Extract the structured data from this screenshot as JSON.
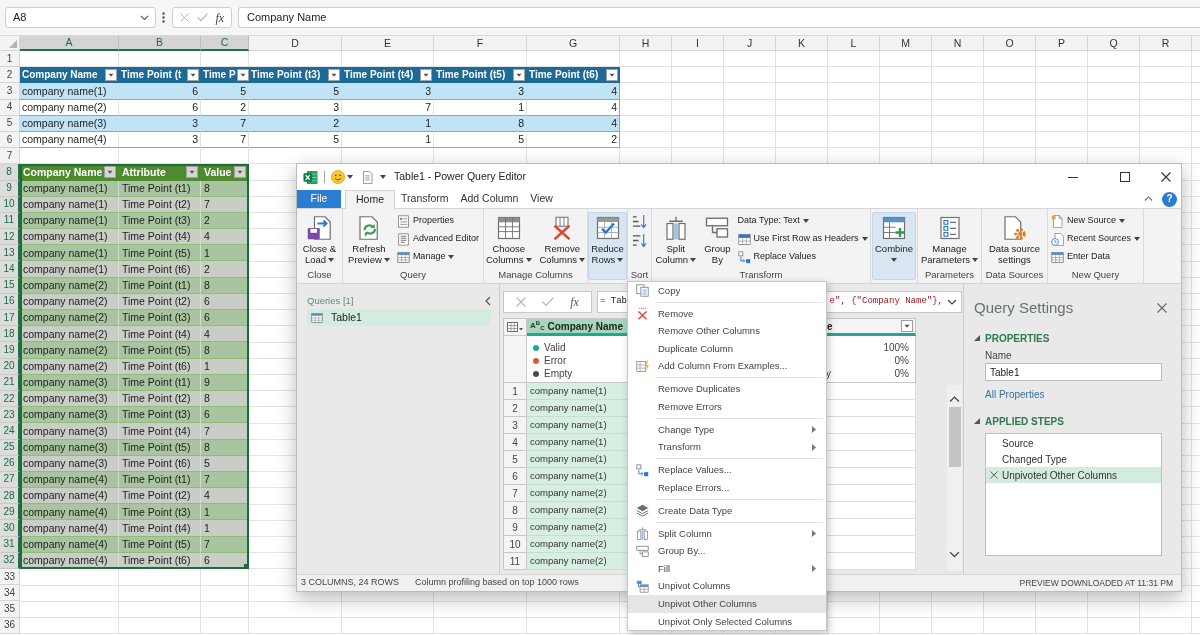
{
  "formula_bar": {
    "name_box": "A8",
    "fx": "fx",
    "formula": "Company Name"
  },
  "sheet": {
    "columns": [
      {
        "label": "A",
        "selected": true
      },
      {
        "label": "B",
        "selected": true
      },
      {
        "label": "C",
        "selected": true
      },
      {
        "label": "D",
        "selected": false
      },
      {
        "label": "E",
        "selected": false
      },
      {
        "label": "F",
        "selected": false
      },
      {
        "label": "G",
        "selected": false
      },
      {
        "label": "H",
        "selected": false
      },
      {
        "label": "I",
        "selected": false
      },
      {
        "label": "J",
        "selected": false
      },
      {
        "label": "K",
        "selected": false
      },
      {
        "label": "L",
        "selected": false
      },
      {
        "label": "M",
        "selected": false
      },
      {
        "label": "N",
        "selected": false
      },
      {
        "label": "O",
        "selected": false
      },
      {
        "label": "P",
        "selected": false
      },
      {
        "label": "Q",
        "selected": false
      },
      {
        "label": "R",
        "selected": false
      }
    ],
    "rows": [
      {
        "label": "1",
        "selected": false
      },
      {
        "label": "2",
        "selected": false
      },
      {
        "label": "3",
        "selected": false
      },
      {
        "label": "4",
        "selected": false
      },
      {
        "label": "5",
        "selected": false
      },
      {
        "label": "6",
        "selected": false
      },
      {
        "label": "7",
        "selected": false
      },
      {
        "label": "8",
        "selected": true
      },
      {
        "label": "9",
        "selected": true
      },
      {
        "label": "10",
        "selected": true
      },
      {
        "label": "11",
        "selected": true
      },
      {
        "label": "12",
        "selected": true
      },
      {
        "label": "13",
        "selected": true
      },
      {
        "label": "14",
        "selected": true
      },
      {
        "label": "15",
        "selected": true
      },
      {
        "label": "16",
        "selected": true
      },
      {
        "label": "17",
        "selected": true
      },
      {
        "label": "18",
        "selected": true
      },
      {
        "label": "19",
        "selected": true
      },
      {
        "label": "20",
        "selected": true
      },
      {
        "label": "21",
        "selected": true
      },
      {
        "label": "22",
        "selected": true
      },
      {
        "label": "23",
        "selected": true
      },
      {
        "label": "24",
        "selected": true
      },
      {
        "label": "25",
        "selected": true
      },
      {
        "label": "26",
        "selected": true
      },
      {
        "label": "27",
        "selected": true
      },
      {
        "label": "28",
        "selected": true
      },
      {
        "label": "29",
        "selected": true
      },
      {
        "label": "30",
        "selected": true
      },
      {
        "label": "31",
        "selected": true
      },
      {
        "label": "32",
        "selected": true
      },
      {
        "label": "33",
        "selected": false
      },
      {
        "label": "34",
        "selected": false
      },
      {
        "label": "35",
        "selected": false
      },
      {
        "label": "36",
        "selected": false
      }
    ]
  },
  "table_1": {
    "headers": [
      "Company Name",
      "Time Point (t",
      "Time P",
      "Time Point (t3)",
      "Time Point (t4)",
      "Time Point (t5)",
      "Time Point (t6)"
    ],
    "rows": [
      [
        "company name(1)",
        "6",
        "5",
        "5",
        "3",
        "3",
        "4"
      ],
      [
        "company name(2)",
        "6",
        "2",
        "3",
        "7",
        "1",
        "4"
      ],
      [
        "company name(3)",
        "3",
        "7",
        "2",
        "1",
        "8",
        "4"
      ],
      [
        "company name(4)",
        "3",
        "7",
        "5",
        "1",
        "5",
        "2"
      ]
    ]
  },
  "table_2": {
    "selected": true,
    "headers": [
      "Company Name",
      "Attribute",
      "Value"
    ],
    "rows": [
      [
        "company name(1)",
        "Time Point (t1)",
        "8"
      ],
      [
        "company name(1)",
        "Time Point (t2)",
        "7"
      ],
      [
        "company name(1)",
        "Time Point (t3)",
        "2"
      ],
      [
        "company name(1)",
        "Time Point (t4)",
        "4"
      ],
      [
        "company name(1)",
        "Time Point (t5)",
        "1"
      ],
      [
        "company name(1)",
        "Time Point (t6)",
        "2"
      ],
      [
        "company name(2)",
        "Time Point (t1)",
        "8"
      ],
      [
        "company name(2)",
        "Time Point (t2)",
        "6"
      ],
      [
        "company name(2)",
        "Time Point (t3)",
        "6"
      ],
      [
        "company name(2)",
        "Time Point (t4)",
        "4"
      ],
      [
        "company name(2)",
        "Time Point (t5)",
        "8"
      ],
      [
        "company name(2)",
        "Time Point (t6)",
        "1"
      ],
      [
        "company name(3)",
        "Time Point (t1)",
        "9"
      ],
      [
        "company name(3)",
        "Time Point (t2)",
        "8"
      ],
      [
        "company name(3)",
        "Time Point (t3)",
        "6"
      ],
      [
        "company name(3)",
        "Time Point (t4)",
        "7"
      ],
      [
        "company name(3)",
        "Time Point (t5)",
        "8"
      ],
      [
        "company name(3)",
        "Time Point (t6)",
        "5"
      ],
      [
        "company name(4)",
        "Time Point (t1)",
        "7"
      ],
      [
        "company name(4)",
        "Time Point (t2)",
        "4"
      ],
      [
        "company name(4)",
        "Time Point (t3)",
        "1"
      ],
      [
        "company name(4)",
        "Time Point (t4)",
        "1"
      ],
      [
        "company name(4)",
        "Time Point (t5)",
        "7"
      ],
      [
        "company name(4)",
        "Time Point (t6)",
        "6"
      ]
    ]
  },
  "editor": {
    "title": "Table1 - Power Query Editor",
    "tabs": [
      {
        "label": "File",
        "kind": "file",
        "selected": false
      },
      {
        "label": "Home",
        "kind": "tab",
        "selected": true
      },
      {
        "label": "Transform",
        "kind": "tab",
        "selected": false
      },
      {
        "label": "Add Column",
        "kind": "tab",
        "selected": false
      },
      {
        "label": "View",
        "kind": "tab",
        "selected": false
      }
    ],
    "help": "?",
    "ribbon": [
      {
        "label": "Close",
        "buttons": [
          {
            "kind": "large",
            "lines": [
              "Close &",
              "Load"
            ],
            "dropdown": true,
            "highlighted": false
          }
        ]
      },
      {
        "label": "Query",
        "buttons": [
          {
            "kind": "large",
            "lines": [
              "Refresh",
              "Preview"
            ],
            "dropdown": true,
            "highlighted": false
          },
          {
            "kind": "small",
            "label": "Properties",
            "dropdown": false,
            "highlighted": false
          },
          {
            "kind": "small",
            "label": "Advanced Editor",
            "dropdown": false,
            "highlighted": false
          },
          {
            "kind": "small",
            "label": "Manage",
            "dropdown": true,
            "highlighted": false
          }
        ]
      },
      {
        "label": "Manage Columns",
        "buttons": [
          {
            "kind": "large",
            "lines": [
              "Choose",
              "Columns"
            ],
            "dropdown": true,
            "highlighted": false
          },
          {
            "kind": "large",
            "lines": [
              "Remove",
              "Columns"
            ],
            "dropdown": true,
            "highlighted": false
          }
        ]
      },
      {
        "buttons": [
          {
            "kind": "large",
            "lines": [
              "Reduce",
              "Rows"
            ],
            "dropdown": true,
            "highlighted": true
          }
        ]
      },
      {
        "label": "Sort",
        "buttons": [
          {
            "kind": "icon",
            "highlighted": false
          },
          {
            "kind": "icon",
            "highlighted": false
          }
        ]
      },
      {
        "label": "Transform",
        "buttons": [
          {
            "kind": "large",
            "lines": [
              "Split",
              "Column"
            ],
            "dropdown": true,
            "highlighted": false
          },
          {
            "kind": "large",
            "lines": [
              "Group",
              "By"
            ],
            "dropdown": false,
            "highlighted": false
          },
          {
            "kind": "small",
            "label": "Data Type: Text",
            "dropdown": true,
            "highlighted": false
          },
          {
            "kind": "small",
            "label": "Use First Row as Headers",
            "dropdown": true,
            "highlighted": false
          },
          {
            "kind": "small",
            "label": "Replace Values",
            "dropdown": false,
            "highlighted": false
          }
        ]
      },
      {
        "buttons": [
          {
            "kind": "large",
            "lines": [
              "Combine"
            ],
            "dropdown": true,
            "highlighted": true
          }
        ]
      },
      {
        "label": "Parameters",
        "buttons": [
          {
            "kind": "large",
            "lines": [
              "Manage",
              "Parameters"
            ],
            "dropdown": true,
            "highlighted": false
          }
        ]
      },
      {
        "label": "Data Sources",
        "buttons": [
          {
            "kind": "large",
            "lines": [
              "Data source",
              "settings"
            ],
            "dropdown": false,
            "highlighted": false
          }
        ]
      },
      {
        "label": "New Query",
        "buttons": [
          {
            "kind": "small",
            "label": "New Source",
            "dropdown": true,
            "highlighted": false
          },
          {
            "kind": "small",
            "label": "Recent Sources",
            "dropdown": true,
            "highlighted": false
          },
          {
            "kind": "small",
            "label": "Enter Data",
            "dropdown": false,
            "highlighted": false
          }
        ]
      }
    ],
    "queries": {
      "title": "Queries [1]",
      "items": [
        {
          "name": "Table1",
          "selected": true
        }
      ]
    },
    "formula": {
      "fx": "fx",
      "text_left": "= Tab",
      "text_right": "e\", {\"Company Name\"},"
    },
    "preview": {
      "row_numbers": [
        "1",
        "2",
        "3",
        "4",
        "5",
        "6",
        "7",
        "8",
        "9",
        "10",
        "11"
      ],
      "column_1": {
        "type_label": "A$^{B}$$_{C}$",
        "header": "Company Name",
        "selected": true,
        "profile": [
          {
            "label": "Valid",
            "color": "#1aa89a"
          },
          {
            "label": "Error",
            "color": "#e0583b"
          },
          {
            "label": "Empty",
            "color": "#4a4a4a"
          }
        ],
        "cells": [
          "company name(1)",
          "company name(1)",
          "company name(1)",
          "company name(1)",
          "company name(1)",
          "company name(1)",
          "company name(2)",
          "company name(2)",
          "company name(2)",
          "company name(2)",
          "company name(2)"
        ]
      },
      "column_3": {
        "header": "e",
        "selected": false,
        "profile": [
          {
            "value": "100%"
          },
          {
            "value": "0%"
          },
          {
            "label": "y",
            "value": "0%"
          }
        ]
      }
    },
    "settings": {
      "title": "Query Settings",
      "properties": {
        "heading": "PROPERTIES",
        "expanded": true,
        "name_label": "Name",
        "name_value": "Table1",
        "link": "All Properties"
      },
      "applied_steps": {
        "heading": "APPLIED STEPS",
        "expanded": true,
        "steps": [
          {
            "name": "Source",
            "selected": false
          },
          {
            "name": "Changed Type",
            "selected": false
          },
          {
            "name": "Unpivoted Other Columns",
            "selected": true
          }
        ]
      }
    },
    "status": {
      "left": [
        "3 COLUMNS, 24 ROWS",
        "Column profiling based on top 1000 rows"
      ],
      "right": "PREVIEW DOWNLOADED AT 11:31 PM"
    }
  },
  "context_menu": {
    "groups": [
      {
        "items": [
          {
            "label": "Copy",
            "submenu": false,
            "selected": false
          }
        ]
      },
      {
        "items": [
          {
            "label": "Remove",
            "submenu": false,
            "selected": false
          },
          {
            "label": "Remove Other Columns",
            "submenu": false,
            "selected": false
          },
          {
            "label": "Duplicate Column",
            "submenu": false,
            "selected": false
          },
          {
            "label": "Add Column From Examples...",
            "submenu": false,
            "selected": false
          }
        ]
      },
      {
        "items": [
          {
            "label": "Remove Duplicates",
            "submenu": false,
            "selected": false
          },
          {
            "label": "Remove Errors",
            "submenu": false,
            "selected": false
          }
        ]
      },
      {
        "items": [
          {
            "label": "Change Type",
            "submenu": true,
            "selected": false
          },
          {
            "label": "Transform",
            "submenu": true,
            "selected": false
          }
        ]
      },
      {
        "items": [
          {
            "label": "Replace Values...",
            "submenu": false,
            "selected": false
          },
          {
            "label": "Replace Errors...",
            "submenu": false,
            "selected": false
          }
        ]
      },
      {
        "items": [
          {
            "label": "Create Data Type",
            "submenu": false,
            "selected": false
          }
        ]
      },
      {
        "items": [
          {
            "label": "Split Column",
            "submenu": true,
            "selected": false
          },
          {
            "label": "Group By...",
            "submenu": false,
            "selected": false
          },
          {
            "label": "Fill",
            "submenu": true,
            "selected": false
          },
          {
            "label": "Unpivot Columns",
            "submenu": false,
            "selected": false
          },
          {
            "label": "Unpivot Other Columns",
            "submenu": false,
            "selected": true
          },
          {
            "label": "Unpivot Only Selected Columns",
            "submenu": false,
            "selected": false
          }
        ]
      }
    ]
  }
}
